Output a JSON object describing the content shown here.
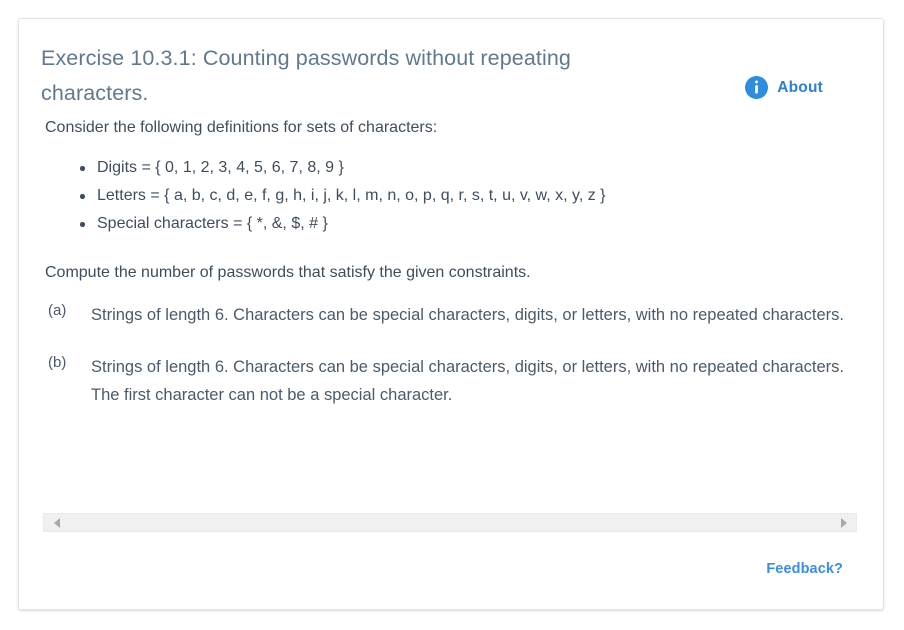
{
  "card": {
    "title": "Exercise 10.3.1: Counting passwords without repeating characters.",
    "about": {
      "label": "About",
      "icon": "info-circle-icon"
    }
  },
  "content": {
    "intro": "Consider the following definitions for sets of characters:",
    "definitions": [
      "Digits = { 0, 1, 2, 3, 4, 5, 6, 7, 8, 9 }",
      "Letters = { a, b, c, d, e, f, g, h, i, j, k, l, m, n, o, p, q, r, s, t, u, v, w, x, y, z }",
      "Special characters = { *, &, $, # }"
    ],
    "instruction": "Compute the number of passwords that satisfy the given constraints.",
    "parts": [
      {
        "label": "(a)",
        "text": "Strings of length 6. Characters can be special characters, digits, or letters, with no repeated characters."
      },
      {
        "label": "(b)",
        "text": "Strings of length 6. Characters can be special characters, digits, or letters, with no repeated characters. The first character can not be a special character."
      }
    ]
  },
  "scrollbar": {
    "left_arrow": "scroll-left-arrow-icon",
    "right_arrow": "scroll-right-arrow-icon"
  },
  "footer": {
    "feedback_label": "Feedback?"
  },
  "colors": {
    "title": "#61788f",
    "body_text": "#3f4d5c",
    "accent_blue": "#2d7fd4",
    "info_icon_bg": "#2e8ddd",
    "link_blue": "#3d8ce0",
    "card_border": "#e4e4e4",
    "scrollbar_track": "#f0f0f0",
    "scrollbar_arrow": "#a8a8a8"
  }
}
